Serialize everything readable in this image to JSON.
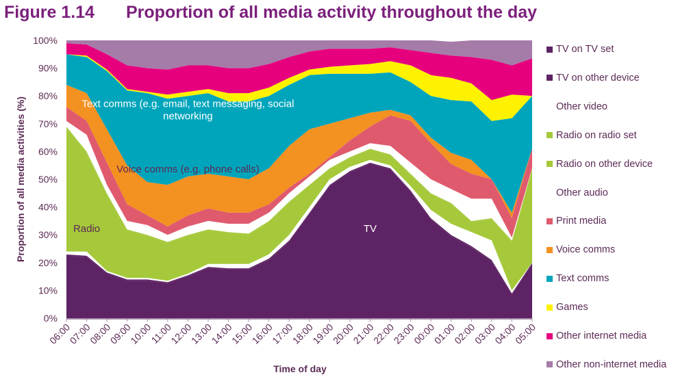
{
  "figure": {
    "number": "Figure 1.14",
    "title": "Proportion of all media activity throughout the day"
  },
  "chart_data": {
    "type": "area",
    "stacked": true,
    "title": "Proportion of all media activity throughout the day",
    "xlabel": "Time of day",
    "ylabel": "Proportion of all media activities (%)",
    "ylim": [
      0,
      100
    ],
    "yticks": [
      "0%",
      "10%",
      "20%",
      "30%",
      "40%",
      "50%",
      "60%",
      "70%",
      "80%",
      "90%",
      "100%"
    ],
    "categories": [
      "06:00",
      "07:00",
      "08:00",
      "09:00",
      "10:00",
      "11:00",
      "12:00",
      "13:00",
      "14:00",
      "15:00",
      "16:00",
      "17:00",
      "18:00",
      "19:00",
      "20:00",
      "21:00",
      "22:00",
      "23:00",
      "00:00",
      "01:00",
      "02:00",
      "03:00",
      "04:00",
      "05:00"
    ],
    "legend_position": "right",
    "series": [
      {
        "name": "TV on TV set",
        "color": "#5e2364",
        "values": [
          22.5,
          22,
          16,
          13.5,
          13.5,
          12.5,
          15,
          18,
          17.5,
          17.5,
          21,
          27.5,
          37.5,
          47.5,
          52.5,
          55.5,
          53.5,
          45.5,
          35.5,
          29.5,
          25.5,
          20.5,
          8.5,
          19.5
        ]
      },
      {
        "name": "TV on other device",
        "color": "#5e2364",
        "values": [
          0.5,
          0.5,
          0.5,
          0.5,
          0.5,
          0.5,
          0.5,
          0.5,
          0.5,
          0.5,
          0.5,
          0.5,
          0.5,
          0.5,
          0.5,
          0.5,
          0.5,
          0.5,
          0.5,
          0.5,
          0.5,
          0.5,
          0.5,
          0.5
        ]
      },
      {
        "name": "Other video",
        "color": "#ffffff",
        "values": [
          1,
          1.5,
          0.5,
          0.5,
          0.5,
          0.5,
          0.5,
          1,
          1.5,
          1.5,
          1.5,
          2,
          2,
          2,
          1.5,
          1,
          1,
          1.5,
          3,
          4,
          5,
          7,
          1,
          0
        ]
      },
      {
        "name": "Radio on radio set",
        "color": "#a5c93a",
        "values": [
          44,
          35,
          27.5,
          17,
          15,
          13.5,
          13.5,
          12,
          11,
          10.5,
          11.5,
          11.5,
          7.5,
          3.5,
          3,
          3.5,
          3.5,
          4,
          5.5,
          7,
          3.5,
          7.5,
          17.5,
          33.5
        ]
      },
      {
        "name": "Radio on other device",
        "color": "#a5c93a",
        "values": [
          1,
          1,
          0.5,
          0.5,
          0.5,
          0.5,
          0.5,
          0.5,
          0.5,
          0.5,
          0.5,
          0.5,
          0.5,
          0.5,
          0.5,
          0.5,
          0.5,
          0.5,
          0.5,
          0.5,
          0.5,
          0.5,
          0.5,
          0.5
        ]
      },
      {
        "name": "Other audio",
        "color": "#ffffff",
        "values": [
          2,
          6,
          3,
          3,
          3.5,
          2.5,
          3,
          3,
          3,
          3.5,
          3,
          3,
          3,
          3,
          2,
          2,
          3,
          4,
          5,
          5,
          8,
          7,
          1,
          0
        ]
      },
      {
        "name": "Print media",
        "color": "#e05a6e",
        "values": [
          5,
          5,
          8,
          6,
          3.5,
          3,
          4,
          4.5,
          4,
          4,
          3,
          2,
          1,
          1,
          4,
          6,
          11,
          15,
          13,
          9,
          9,
          7,
          7,
          7
        ]
      },
      {
        "name": "Voice comms",
        "color": "#f39121",
        "values": [
          8,
          10,
          12,
          14,
          12,
          15,
          14,
          12.5,
          13,
          12,
          13,
          15,
          16,
          12,
          8,
          5,
          2,
          2,
          2,
          4,
          5,
          0,
          2,
          0
        ]
      },
      {
        "name": "Text comms",
        "color": "#00a5bb",
        "values": [
          11,
          13,
          21,
          27,
          32,
          31,
          29,
          29,
          27,
          28,
          26,
          22,
          19.5,
          18,
          16,
          14,
          13.5,
          12,
          15,
          19,
          21,
          21,
          34,
          19
        ]
      },
      {
        "name": "Games",
        "color": "#fff200",
        "values": [
          0,
          0.5,
          0.5,
          0.5,
          0.5,
          1.5,
          1.5,
          1.5,
          3,
          3,
          3,
          2.5,
          2,
          2.5,
          3,
          3.5,
          4,
          6,
          7.5,
          8,
          6.5,
          7.5,
          8.5,
          0
        ]
      },
      {
        "name": "Other internet media",
        "color": "#e6007e",
        "values": [
          4,
          4,
          5.5,
          8.5,
          8.5,
          9,
          9.5,
          8.5,
          9,
          9,
          8.5,
          7.5,
          6.5,
          6.5,
          6,
          5.5,
          5,
          5.5,
          8,
          8,
          9.5,
          14.5,
          10.5,
          13.5
        ]
      },
      {
        "name": "Other non-internet media",
        "color": "#a57ba8",
        "values": [
          1,
          1.5,
          5,
          9,
          10,
          10.5,
          9,
          9,
          10,
          10,
          8.5,
          6,
          4,
          3,
          3,
          3,
          2.5,
          3.5,
          4.5,
          5,
          6,
          7,
          9,
          6.5
        ]
      }
    ],
    "annotations": [
      {
        "text": "Text comms (e.g. email, text messaging, social",
        "color": "#ffffff",
        "x_category": "12:00",
        "y_value": 76
      },
      {
        "text": "networking",
        "color": "#ffffff",
        "x_category": "12:00",
        "y_value": 71.5
      },
      {
        "text": "Voice comms (e.g. phone calls)",
        "color": "#5b2a55",
        "x_category": "12:00",
        "y_value": 52.5
      },
      {
        "text": "Radio",
        "color": "#5b2a55",
        "x_category": "07:00",
        "y_value": 31
      },
      {
        "text": "TV",
        "color": "#ffffff",
        "x_category": "21:00",
        "y_value": 31
      }
    ]
  },
  "legend": [
    {
      "label": "TV on TV set",
      "swatch": "#5e2364"
    },
    {
      "label": "TV on other device",
      "swatch": "#5e2364"
    },
    {
      "label": "Other video",
      "swatch": "none"
    },
    {
      "label": "Radio on radio set",
      "swatch": "#a5c93a"
    },
    {
      "label": "Radio on other device",
      "swatch": "#a5c93a"
    },
    {
      "label": "Other audio",
      "swatch": "none"
    },
    {
      "label": "Print media",
      "swatch": "#e05a6e"
    },
    {
      "label": "Voice comms",
      "swatch": "#f39121"
    },
    {
      "label": "Text comms",
      "swatch": "#00a5bb"
    },
    {
      "label": "Games",
      "swatch": "#fff200"
    },
    {
      "label": "Other internet media",
      "swatch": "#e6007e"
    },
    {
      "label": "Other non-internet media",
      "swatch": "#a57ba8"
    }
  ]
}
